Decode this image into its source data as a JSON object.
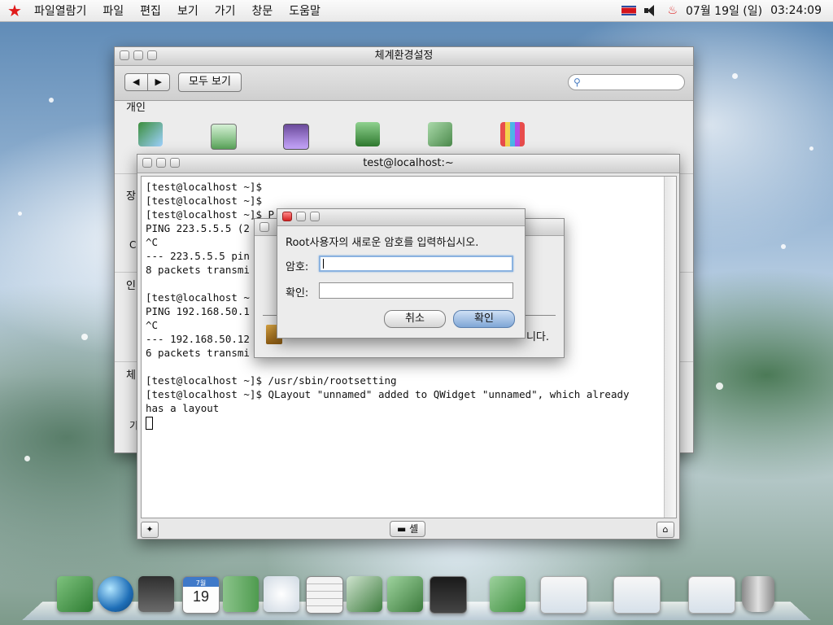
{
  "menubar": {
    "items": [
      "파일열람기",
      "파일",
      "편집",
      "보기",
      "가기",
      "창문",
      "도움말"
    ],
    "date": "07월 19일 (일)",
    "time": "03:24:09"
  },
  "prefs_window": {
    "title": "체계환경설정",
    "show_all": "모두 보기",
    "nav_back": "◀",
    "nav_forward": "▶",
    "section_personal": "개인",
    "left_labels": [
      "장",
      "CI",
      "인",
      "체",
      "기"
    ]
  },
  "terminal": {
    "title": "test@localhost:~",
    "lines": [
      "[test@localhost ~]$",
      "[test@localhost ~]$",
      "[test@localhost ~]$ P",
      "PING 223.5.5.5 (2",
      "^C",
      "--- 223.5.5.5 pin",
      "8 packets transmi",
      "",
      "[test@localhost ~",
      "PING 192.168.50.1",
      "^C",
      "--- 192.168.50.12",
      "6 packets transmi",
      "",
      "[test@localhost ~]$ /usr/sbin/rootsetting",
      "[test@localhost ~]$ QLayout \"unnamed\" added to QWidget \"unnamed\", which already",
      "has a layout"
    ],
    "shell_tab": "셸"
  },
  "behind_dialog": {
    "partial_text": "니다."
  },
  "root_dialog": {
    "prompt": "Root사용자의 새로운 암호를 입력하십시오.",
    "password_label": "암호:",
    "password_value": "",
    "confirm_label": "확인:",
    "confirm_value": "",
    "cancel_label": "취소",
    "ok_label": "확인"
  },
  "dock": {
    "calendar_month": "7월",
    "calendar_day": "19",
    "items": [
      "file-manager",
      "browser",
      "video-player",
      "calendar",
      "contacts",
      "image-viewer",
      "calculator",
      "system-settings",
      "notes",
      "terminal",
      "office",
      "window-thumbnail-1",
      "window-thumbnail-2",
      "window-thumbnail-3",
      "trash"
    ]
  },
  "colors": {
    "close_red": "#d42020",
    "default_button": "#7fa6d6",
    "focus_ring": "#8ab2e0"
  }
}
